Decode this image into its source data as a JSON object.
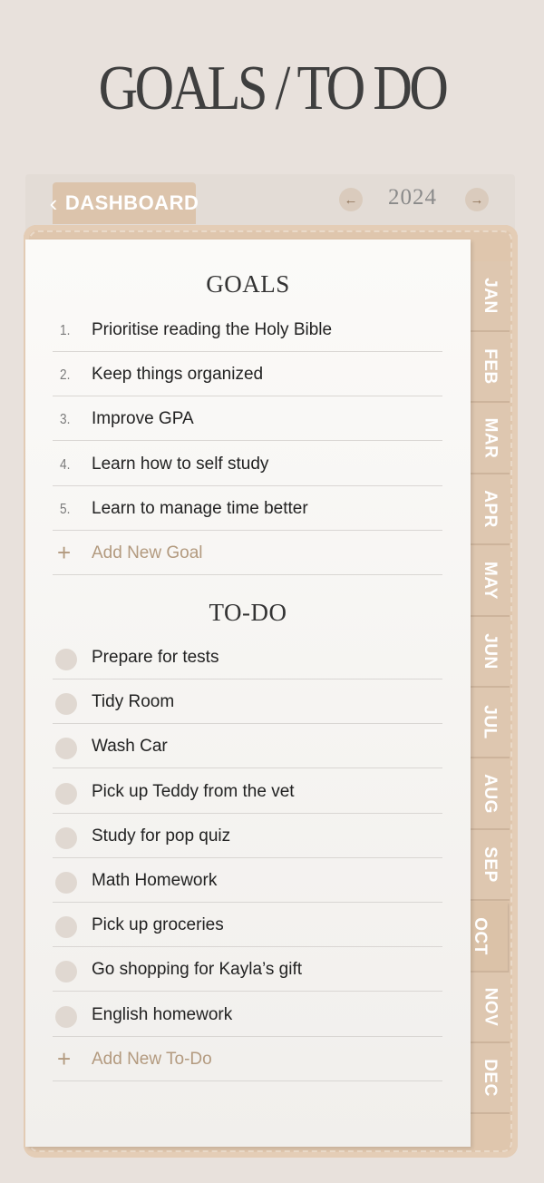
{
  "page": {
    "title": "GOALS / TO DO"
  },
  "nav": {
    "dashboard_label": "DASHBOARD",
    "year": "2024",
    "prev_icon": "arrow-left-icon",
    "next_icon": "arrow-right-icon"
  },
  "months": [
    "JAN",
    "FEB",
    "MAR",
    "APR",
    "MAY",
    "JUN",
    "JUL",
    "AUG",
    "SEP",
    "OCT",
    "NOV",
    "DEC"
  ],
  "active_month": "OCT",
  "goals": {
    "heading": "GOALS",
    "items": [
      {
        "num": "1.",
        "text": "Prioritise reading the Holy Bible"
      },
      {
        "num": "2.",
        "text": "Keep things organized"
      },
      {
        "num": "3.",
        "text": "Improve GPA"
      },
      {
        "num": "4.",
        "text": "Learn how to self study"
      },
      {
        "num": "5.",
        "text": "Learn to manage time better"
      }
    ],
    "add_label": "Add New Goal"
  },
  "todo": {
    "heading": "TO-DO",
    "items": [
      "Prepare for tests",
      "Tidy Room",
      "Wash Car",
      "Pick up Teddy from the vet",
      "Study for pop quiz",
      "Math Homework",
      "Pick up groceries",
      "Go shopping for Kayla’s gift",
      "English homework"
    ],
    "add_label": "Add New To-Do"
  },
  "colors": {
    "background": "#e8e1dc",
    "accent": "#dcc4ac",
    "add_text": "#b39a7f"
  }
}
